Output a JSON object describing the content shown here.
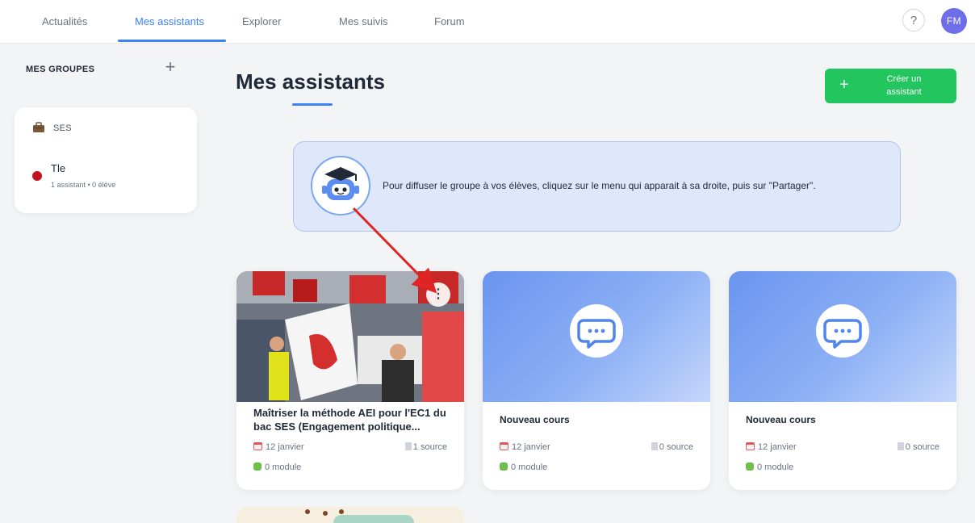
{
  "nav": {
    "tabs": [
      {
        "label": "Actualités"
      },
      {
        "label": "Mes assistants"
      },
      {
        "label": "Explorer"
      },
      {
        "label": "Mes suivis"
      },
      {
        "label": "Forum"
      }
    ],
    "help_label": "?",
    "avatar_initials": "FM",
    "avatar_color": "#6d6ee8",
    "accent_color": "#3b82f6"
  },
  "sidebar": {
    "title": "MES GROUPES",
    "add_icon": "plus-icon",
    "groups": [
      {
        "name": "SES",
        "icon": "briefcase-icon",
        "classes": [
          {
            "name": "Tle",
            "meta": "1 assistant • 0 élève",
            "color": "#c1121f"
          }
        ]
      }
    ]
  },
  "main": {
    "title": "Mes assistants",
    "create_button": {
      "line1": "Créer un",
      "line2": "assistant",
      "color": "#22c55e"
    },
    "banner": {
      "icon": "robot-graduate-icon",
      "text": "Pour diffuser le groupe à vos élèves, cliquez sur le menu qui apparait à sa droite, puis sur \"Partager\"."
    },
    "cards": [
      {
        "title": "Maîtriser la méthode AEI pour l'EC1 du bac SES (Engagement politique...",
        "date": "12 janvier",
        "sources": "1 source",
        "modules": "0 module",
        "cover": "photo"
      },
      {
        "title": "Nouveau cours",
        "date": "12 janvier",
        "sources": "0 source",
        "modules": "0 module",
        "cover": "chat-icon"
      },
      {
        "title": "Nouveau cours",
        "date": "12 janvier",
        "sources": "0 source",
        "modules": "0 module",
        "cover": "chat-icon"
      }
    ]
  }
}
